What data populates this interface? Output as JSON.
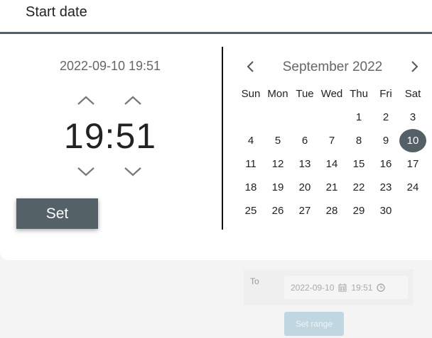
{
  "title": "Start date",
  "selected_datetime": "2022-09-10 19:51",
  "time": {
    "hours": "19",
    "minutes": "51",
    "separator": ":"
  },
  "set_label": "Set",
  "calendar": {
    "month_label": "September 2022",
    "weekdays": [
      "Sun",
      "Mon",
      "Tue",
      "Wed",
      "Thu",
      "Fri",
      "Sat"
    ],
    "weeks": [
      [
        "",
        "",
        "",
        "",
        "1",
        "2",
        "3"
      ],
      [
        "4",
        "5",
        "6",
        "7",
        "8",
        "9",
        "10"
      ],
      [
        "11",
        "12",
        "13",
        "14",
        "15",
        "16",
        "17"
      ],
      [
        "18",
        "19",
        "20",
        "21",
        "22",
        "23",
        "24"
      ],
      [
        "25",
        "26",
        "27",
        "28",
        "29",
        "30",
        ""
      ]
    ],
    "selected_day": "10"
  },
  "range": {
    "to_label": "To",
    "date": "2022-09-10",
    "time": "19:51",
    "set_range_label": "Set range"
  },
  "colors": {
    "accent": "#546268",
    "range_button": "#c0d7e1"
  }
}
